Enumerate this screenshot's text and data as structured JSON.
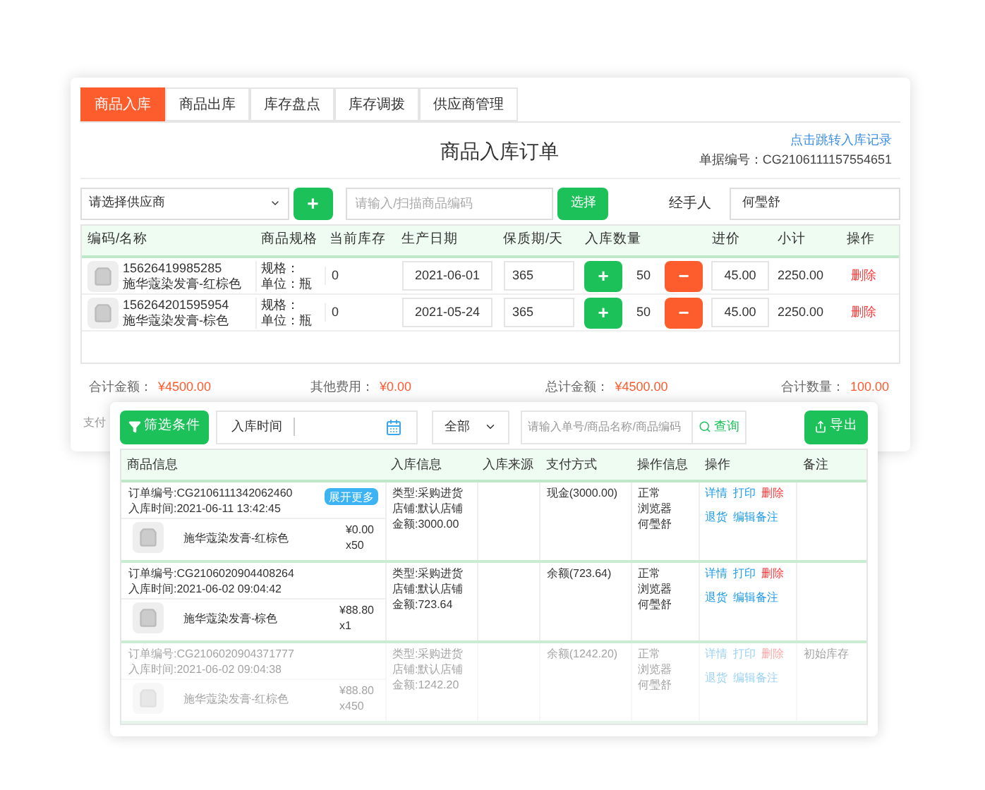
{
  "tabs": [
    {
      "label": "商品入库",
      "selected": true
    },
    {
      "label": "商品出库",
      "selected": false
    },
    {
      "label": "库存盘点",
      "selected": false
    },
    {
      "label": "库存调拨",
      "selected": false
    },
    {
      "label": "供应商管理",
      "selected": false
    }
  ],
  "order": {
    "title": "商品入库订单",
    "link": "点击跳转入库记录",
    "number": "单据编号：CG2106111157554651",
    "supplier_select": {
      "value": "请选择供应商",
      "add": "+"
    },
    "code_field": {
      "placeholder": "请输入/扫描商品编码"
    },
    "choose_button": "选择",
    "handler_label": "经手人",
    "handler_field": {
      "value": "何璺舒"
    },
    "columns": [
      "编码/名称",
      "商品规格",
      "当前库存",
      "生产日期",
      "保质期/天",
      "入库数量",
      "进价",
      "小计",
      "操作"
    ],
    "rows": [
      {
        "code": "15626419985285",
        "name": "施华蔻染发膏-红棕色",
        "spec": "规格：",
        "unit": "单位：瓶",
        "stock": "0",
        "date": "2021-06-01",
        "shelf_life": "365",
        "plus": "+",
        "qty": "50",
        "minus": "−",
        "price": "45.00",
        "subtotal": "2250.00",
        "action": "删除"
      },
      {
        "code": "156264201595954",
        "name": "施华蔻染发膏-棕色",
        "spec": "规格：",
        "unit": "单位：瓶",
        "stock": "0",
        "date": "2021-05-24",
        "shelf_life": "365",
        "plus": "+",
        "qty": "50",
        "minus": "−",
        "price": "45.00",
        "subtotal": "2250.00",
        "action": "删除"
      }
    ],
    "totals": [
      {
        "label": "合计金额：",
        "value": "¥4500.00"
      },
      {
        "label": "其他费用：",
        "value": "¥0.00"
      },
      {
        "label": "总计金额：",
        "value": "¥4500.00"
      },
      {
        "label": "合计数量：",
        "value": "100.00"
      }
    ],
    "partial_label": "支付"
  },
  "records": {
    "filter_button": "筛选条件",
    "date_field": {
      "label": "入库时间"
    },
    "status_select": {
      "value": "全部"
    },
    "search_field": {
      "placeholder": "请输入单号/商品名称/商品编码"
    },
    "search_button": "查询",
    "export_button": "导出",
    "columns": [
      "商品信息",
      "入库信息",
      "入库来源",
      "支付方式",
      "操作信息",
      "操作",
      "备注"
    ],
    "rows": [
      {
        "faded": false,
        "order_no": "订单编号:CG2106111342062460",
        "time": "入库时间:2021-06-11 13:42:45",
        "badge": "展开更多",
        "product": "施华蔻染发膏-红棕色",
        "price": "¥0.00",
        "qty": "x50",
        "info": [
          "类型:采购进货",
          "店铺:默认店铺",
          "金额:3000.00"
        ],
        "payment": "现金(3000.00)",
        "operator": [
          "正常",
          "浏览器",
          "何璺舒"
        ],
        "actions": [
          {
            "label": "详情",
            "kind": "link"
          },
          {
            "label": "打印",
            "kind": "link"
          },
          {
            "label": "删除",
            "kind": "danger"
          },
          {
            "label": "退货",
            "kind": "link"
          },
          {
            "label": "编辑备注",
            "kind": "link"
          }
        ]
      },
      {
        "faded": false,
        "order_no": "订单编号:CG2106020904408264",
        "time": "入库时间:2021-06-02 09:04:42",
        "product": "施华蔻染发膏-棕色",
        "price": "¥88.80",
        "qty": "x1",
        "info": [
          "类型:采购进货",
          "店铺:默认店铺",
          "金额:723.64"
        ],
        "payment": "余额(723.64)",
        "operator": [
          "正常",
          "浏览器",
          "何璺舒"
        ],
        "actions": [
          {
            "label": "详情",
            "kind": "link"
          },
          {
            "label": "打印",
            "kind": "link"
          },
          {
            "label": "删除",
            "kind": "danger"
          },
          {
            "label": "退货",
            "kind": "link"
          },
          {
            "label": "编辑备注",
            "kind": "link"
          }
        ]
      },
      {
        "faded": true,
        "order_no": "订单编号:CG2106020904371777",
        "time": "入库时间:2021-06-02 09:04:38",
        "product": "施华蔻染发膏-红棕色",
        "price": "¥88.80",
        "qty": "x450",
        "info": [
          "类型:采购进货",
          "店铺:默认店铺",
          "金额:1242.20"
        ],
        "payment": "余额(1242.20)",
        "operator": [
          "正常",
          "浏览器",
          "何璺舒"
        ],
        "actions": [
          {
            "label": "详情",
            "kind": "link"
          },
          {
            "label": "打印",
            "kind": "link"
          },
          {
            "label": "删除",
            "kind": "danger"
          },
          {
            "label": "退货",
            "kind": "link"
          },
          {
            "label": "编辑备注",
            "kind": "link"
          }
        ],
        "remark": "初始库存"
      }
    ]
  }
}
